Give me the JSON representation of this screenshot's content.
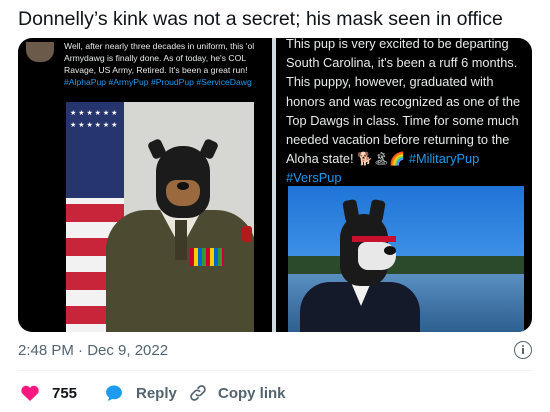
{
  "tweet": {
    "text": "Donnelly’s kink was not a secret; his mask seen in office",
    "timestamp": "2:48 PM · Dec 9, 2022"
  },
  "media": {
    "left_caption": "Well, after nearly three decades in uniform, this 'ol Armydawg is finally done. As of today, he's COL Ravage, US Army, Retired. It's been a great run!",
    "left_tags": "#AlphaPup #ArmyPup #ProudPup #ServiceDawg",
    "right_caption": "This pup is very excited to be departing South Carolina, it's been a ruff 6 months. This puppy, however, graduated with honors and was recognized as one of the Top Dawgs in class. Time for some much needed vacation before returning to the Aloha state! 🐕🏝🌈",
    "right_tags": "#MilitaryPup #VersPup"
  },
  "actions": {
    "like_count": "755",
    "reply_label": "Reply",
    "copy_link_label": "Copy link"
  },
  "colors": {
    "like": "#f91880",
    "reply": "#1d9bf0",
    "link": "#536471"
  }
}
